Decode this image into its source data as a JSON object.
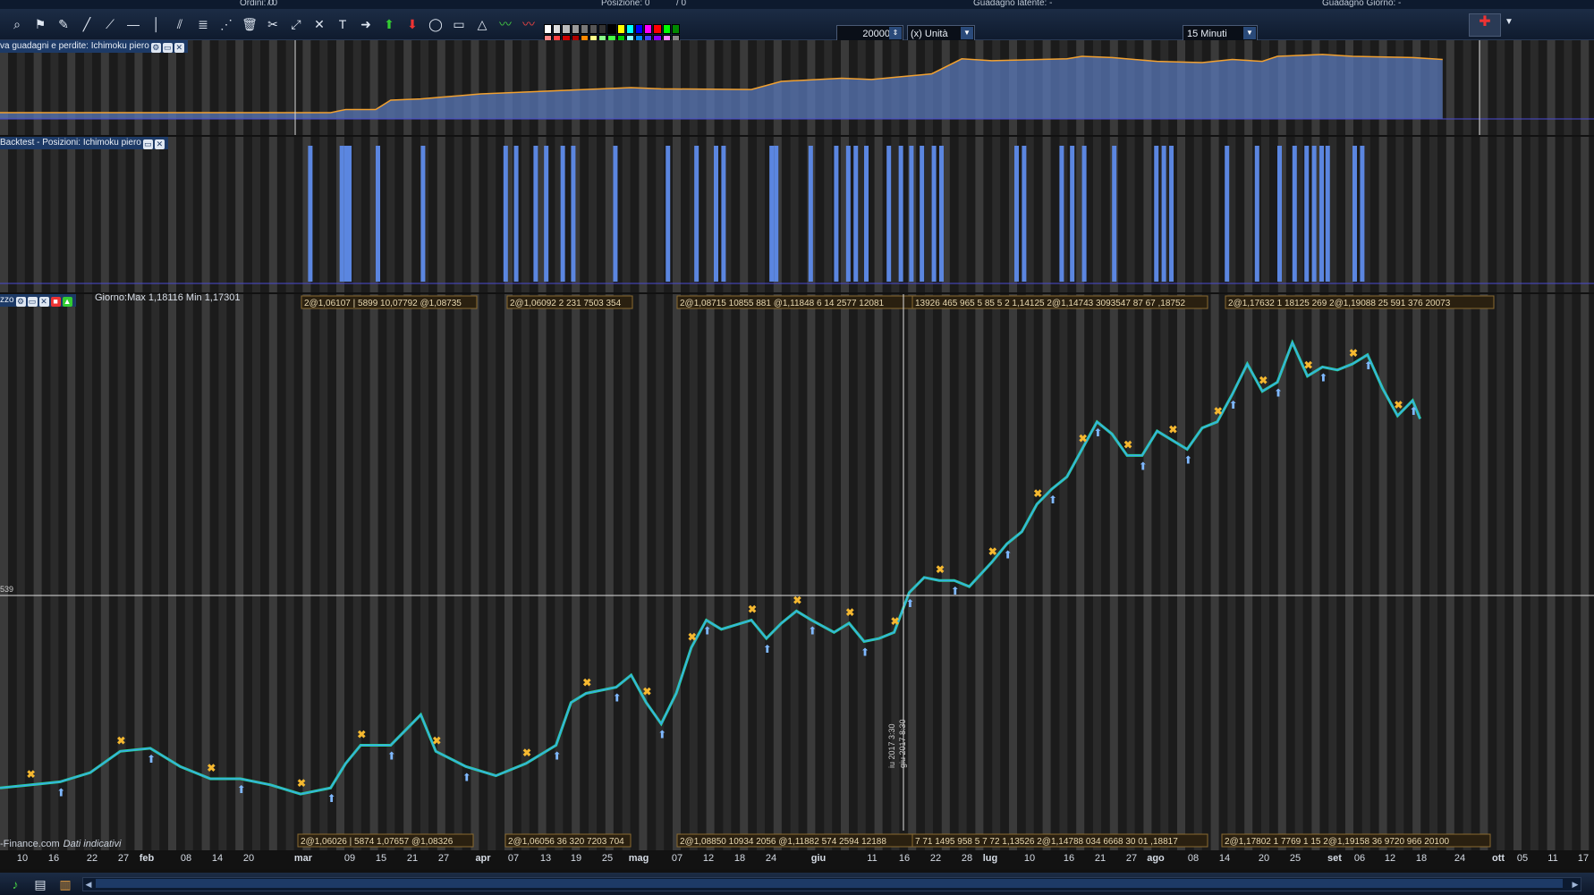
{
  "topbar": {
    "ordini": "Ordini: 0",
    "ordini_b": "/ 0",
    "posizione": "Posizione: 0",
    "posizione_b": "/ 0",
    "guadagno_latente": "Guadagno latente: -",
    "guadagno_giorno": "Guadagno Giorno: -"
  },
  "toolbar": {
    "quantity": "20000",
    "unit": "(x) Unità",
    "timeframe": "15 Minuti"
  },
  "panels": {
    "equity_title": "va guadagni e perdite: Ichimoku piero",
    "positions_title": "Backtest - Posizioni: Ichimoku piero",
    "price_title": "zzo",
    "info": "Giorno:Max 1,18116 Min 1,17301"
  },
  "price_line_label": "539",
  "credit": {
    "source": "-Finance.com",
    "note": "Dati indicativi"
  },
  "vertical_marker": "iu 2017 3:30",
  "vertical_marker_b": "giu 2017 8:30",
  "x_axis": [
    {
      "t": "10",
      "x": 25
    },
    {
      "t": "16",
      "x": 60
    },
    {
      "t": "22",
      "x": 103
    },
    {
      "t": "27",
      "x": 138
    },
    {
      "t": "feb",
      "x": 164,
      "m": true
    },
    {
      "t": "08",
      "x": 208
    },
    {
      "t": "14",
      "x": 243
    },
    {
      "t": "20",
      "x": 278
    },
    {
      "t": "mar",
      "x": 339,
      "m": true
    },
    {
      "t": "09",
      "x": 391
    },
    {
      "t": "15",
      "x": 426
    },
    {
      "t": "21",
      "x": 461
    },
    {
      "t": "27",
      "x": 496
    },
    {
      "t": "apr",
      "x": 540,
      "m": true
    },
    {
      "t": "07",
      "x": 574
    },
    {
      "t": "13",
      "x": 610
    },
    {
      "t": "19",
      "x": 644
    },
    {
      "t": "25",
      "x": 679
    },
    {
      "t": "mag",
      "x": 714,
      "m": true
    },
    {
      "t": "07",
      "x": 757
    },
    {
      "t": "12",
      "x": 792
    },
    {
      "t": "18",
      "x": 827
    },
    {
      "t": "24",
      "x": 862
    },
    {
      "t": "giu",
      "x": 915,
      "m": true
    },
    {
      "t": "11",
      "x": 975
    },
    {
      "t": "16",
      "x": 1011
    },
    {
      "t": "22",
      "x": 1046
    },
    {
      "t": "28",
      "x": 1081
    },
    {
      "t": "lug",
      "x": 1107,
      "m": true
    },
    {
      "t": "10",
      "x": 1151
    },
    {
      "t": "16",
      "x": 1195
    },
    {
      "t": "21",
      "x": 1230
    },
    {
      "t": "27",
      "x": 1265
    },
    {
      "t": "ago",
      "x": 1292,
      "m": true
    },
    {
      "t": "08",
      "x": 1334
    },
    {
      "t": "14",
      "x": 1369
    },
    {
      "t": "20",
      "x": 1413
    },
    {
      "t": "25",
      "x": 1448
    },
    {
      "t": "set",
      "x": 1492,
      "m": true
    },
    {
      "t": "06",
      "x": 1520
    },
    {
      "t": "12",
      "x": 1554
    },
    {
      "t": "18",
      "x": 1589
    },
    {
      "t": "24",
      "x": 1632
    },
    {
      "t": "ott",
      "x": 1675,
      "m": true
    },
    {
      "t": "05",
      "x": 1702
    },
    {
      "t": "11",
      "x": 1736
    },
    {
      "t": "17",
      "x": 1770
    }
  ],
  "top_labels": [
    {
      "x": 337,
      "w": 196,
      "t": "2@1,06107 | 5899 10,07792 @1,08735"
    },
    {
      "x": 567,
      "w": 140,
      "t": "2@1,06092 2 231 7503 354"
    },
    {
      "x": 757,
      "w": 275,
      "t": "2@1,08715 10855 881 @1,11848 6 14 2577 12081"
    },
    {
      "x": 1020,
      "w": 330,
      "t": "13926 465 965 5 85 5 2 1,14125 2@1,14743 3093547 87 67 ,18752"
    },
    {
      "x": 1370,
      "w": 300,
      "t": "2@1,17632 1 18125 269 2@1,19088 25 591 376 20073"
    }
  ],
  "bottom_labels": [
    {
      "x": 333,
      "w": 196,
      "t": "2@1,06026 | 5874 1,07657 @1,08326"
    },
    {
      "x": 565,
      "w": 140,
      "t": "2@1,06056 36 320 7203 704"
    },
    {
      "x": 757,
      "w": 275,
      "t": "2@1,08850 10934 2056 @1,11882 574 2594 12188"
    },
    {
      "x": 1020,
      "w": 330,
      "t": "7 71 1495 958 5 7 72 1,13526 2@1,14788 034 6668 30 01 ,18817"
    },
    {
      "x": 1366,
      "w": 300,
      "t": "2@1,17802 1 7769 1 15 2@1,19158 36 9720 966 20100"
    }
  ],
  "chart_data": [
    {
      "type": "area",
      "name": "equity",
      "points": [
        [
          0,
          0.1
        ],
        [
          0.22,
          0.1
        ],
        [
          0.23,
          0.15
        ],
        [
          0.25,
          0.15
        ],
        [
          0.26,
          0.3
        ],
        [
          0.28,
          0.32
        ],
        [
          0.32,
          0.4
        ],
        [
          0.34,
          0.42
        ],
        [
          0.38,
          0.46
        ],
        [
          0.42,
          0.5
        ],
        [
          0.44,
          0.48
        ],
        [
          0.5,
          0.47
        ],
        [
          0.52,
          0.6
        ],
        [
          0.56,
          0.65
        ],
        [
          0.58,
          0.63
        ],
        [
          0.62,
          0.72
        ],
        [
          0.64,
          0.96
        ],
        [
          0.66,
          0.93
        ],
        [
          0.71,
          0.96
        ],
        [
          0.72,
          1.0
        ],
        [
          0.74,
          0.98
        ],
        [
          0.77,
          0.92
        ],
        [
          0.8,
          0.9
        ],
        [
          0.82,
          0.95
        ],
        [
          0.84,
          0.92
        ],
        [
          0.85,
          1.0
        ],
        [
          0.88,
          1.03
        ],
        [
          0.9,
          1.0
        ],
        [
          0.94,
          0.98
        ],
        [
          0.96,
          0.95
        ]
      ]
    },
    {
      "type": "bar",
      "name": "positions",
      "x": [
        0.205,
        0.226,
        0.229,
        0.231,
        0.25,
        0.28,
        0.335,
        0.342,
        0.355,
        0.362,
        0.373,
        0.38,
        0.408,
        0.443,
        0.462,
        0.475,
        0.48,
        0.512,
        0.515,
        0.538,
        0.555,
        0.563,
        0.568,
        0.575,
        0.59,
        0.598,
        0.605,
        0.612,
        0.62,
        0.625,
        0.675,
        0.68,
        0.705,
        0.712,
        0.72,
        0.74,
        0.768,
        0.773,
        0.778,
        0.815,
        0.835,
        0.85,
        0.86,
        0.868,
        0.873,
        0.878,
        0.882,
        0.9,
        0.905
      ]
    },
    {
      "type": "line",
      "name": "price",
      "x_range": [
        0,
        1
      ],
      "y_range": [
        1.04,
        1.21
      ],
      "points": [
        [
          0,
          1.054
        ],
        [
          0.02,
          1.055
        ],
        [
          0.04,
          1.056
        ],
        [
          0.06,
          1.059
        ],
        [
          0.08,
          1.066
        ],
        [
          0.1,
          1.067
        ],
        [
          0.12,
          1.061
        ],
        [
          0.14,
          1.057
        ],
        [
          0.16,
          1.057
        ],
        [
          0.18,
          1.055
        ],
        [
          0.2,
          1.052
        ],
        [
          0.22,
          1.054
        ],
        [
          0.23,
          1.062
        ],
        [
          0.24,
          1.068
        ],
        [
          0.26,
          1.068
        ],
        [
          0.28,
          1.078
        ],
        [
          0.29,
          1.066
        ],
        [
          0.31,
          1.061
        ],
        [
          0.33,
          1.058
        ],
        [
          0.35,
          1.062
        ],
        [
          0.37,
          1.068
        ],
        [
          0.38,
          1.082
        ],
        [
          0.39,
          1.085
        ],
        [
          0.41,
          1.087
        ],
        [
          0.42,
          1.091
        ],
        [
          0.43,
          1.082
        ],
        [
          0.44,
          1.075
        ],
        [
          0.45,
          1.085
        ],
        [
          0.46,
          1.1
        ],
        [
          0.47,
          1.109
        ],
        [
          0.48,
          1.106
        ],
        [
          0.5,
          1.109
        ],
        [
          0.51,
          1.103
        ],
        [
          0.52,
          1.108
        ],
        [
          0.53,
          1.112
        ],
        [
          0.54,
          1.109
        ],
        [
          0.555,
          1.105
        ],
        [
          0.565,
          1.108
        ],
        [
          0.575,
          1.102
        ],
        [
          0.585,
          1.103
        ],
        [
          0.595,
          1.105
        ],
        [
          0.605,
          1.118
        ],
        [
          0.615,
          1.123
        ],
        [
          0.625,
          1.122
        ],
        [
          0.635,
          1.122
        ],
        [
          0.645,
          1.12
        ],
        [
          0.66,
          1.128
        ],
        [
          0.67,
          1.134
        ],
        [
          0.68,
          1.138
        ],
        [
          0.69,
          1.147
        ],
        [
          0.7,
          1.152
        ],
        [
          0.71,
          1.156
        ],
        [
          0.72,
          1.165
        ],
        [
          0.73,
          1.174
        ],
        [
          0.74,
          1.17
        ],
        [
          0.75,
          1.163
        ],
        [
          0.76,
          1.163
        ],
        [
          0.77,
          1.171
        ],
        [
          0.78,
          1.168
        ],
        [
          0.79,
          1.165
        ],
        [
          0.8,
          1.172
        ],
        [
          0.81,
          1.174
        ],
        [
          0.82,
          1.183
        ],
        [
          0.83,
          1.193
        ],
        [
          0.84,
          1.184
        ],
        [
          0.85,
          1.187
        ],
        [
          0.86,
          1.2
        ],
        [
          0.87,
          1.189
        ],
        [
          0.88,
          1.192
        ],
        [
          0.89,
          1.191
        ],
        [
          0.9,
          1.193
        ],
        [
          0.91,
          1.196
        ],
        [
          0.92,
          1.185
        ],
        [
          0.93,
          1.176
        ],
        [
          0.94,
          1.181
        ],
        [
          0.945,
          1.175
        ]
      ]
    }
  ]
}
